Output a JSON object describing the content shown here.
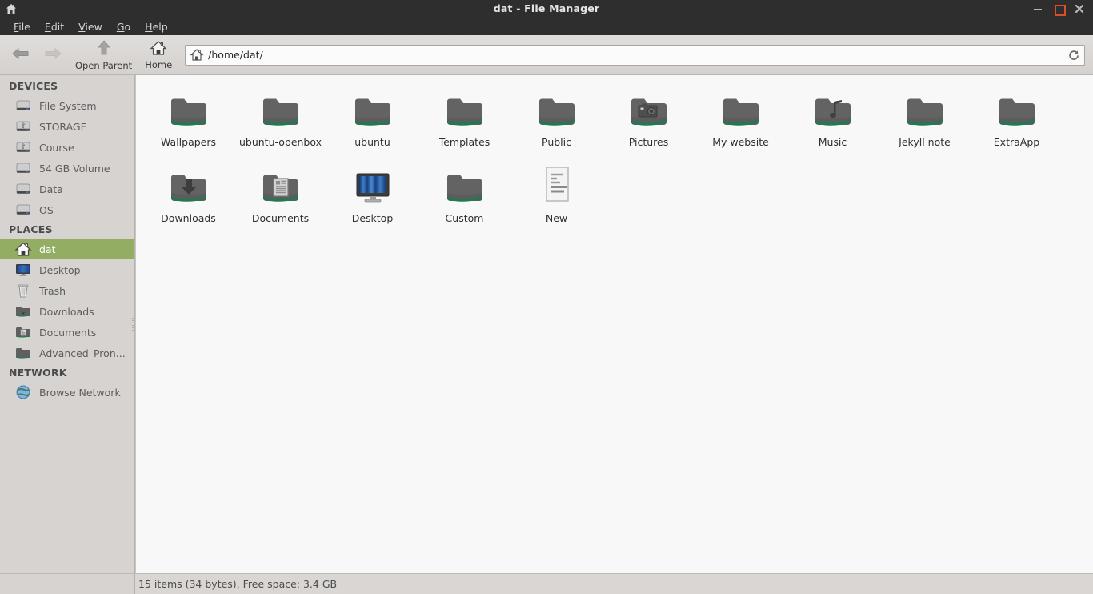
{
  "window": {
    "title": "dat - File Manager",
    "titlebar_icon": "home-icon",
    "controls": {
      "minimize": "minimize-icon",
      "maximize": "maximize-icon",
      "close": "close-icon"
    }
  },
  "menubar": {
    "items": [
      {
        "label": "File",
        "mnemonic": "F",
        "rest": "ile"
      },
      {
        "label": "Edit",
        "mnemonic": "E",
        "rest": "dit"
      },
      {
        "label": "View",
        "mnemonic": "V",
        "rest": "iew"
      },
      {
        "label": "Go",
        "mnemonic": "G",
        "rest": "o"
      },
      {
        "label": "Help",
        "mnemonic": "H",
        "rest": "elp"
      }
    ]
  },
  "toolbar": {
    "back_label": "",
    "forward_label": "",
    "open_parent_label": "Open Parent",
    "home_label": "Home",
    "path_value": "/home/dat/",
    "path_placeholder": "/home/dat/",
    "reload_label": ""
  },
  "sidebar": {
    "sections": [
      {
        "header": "DEVICES",
        "items": [
          {
            "label": "File System",
            "icon": "drive-icon",
            "selected": false
          },
          {
            "label": "STORAGE",
            "icon": "usb-drive-icon",
            "selected": false
          },
          {
            "label": "Course",
            "icon": "usb-drive-icon",
            "selected": false
          },
          {
            "label": "54 GB Volume",
            "icon": "drive-icon",
            "selected": false
          },
          {
            "label": "Data",
            "icon": "drive-icon",
            "selected": false
          },
          {
            "label": "OS",
            "icon": "drive-icon",
            "selected": false
          }
        ]
      },
      {
        "header": "PLACES",
        "items": [
          {
            "label": "dat",
            "icon": "home-icon",
            "selected": true
          },
          {
            "label": "Desktop",
            "icon": "monitor-icon",
            "selected": false
          },
          {
            "label": "Trash",
            "icon": "trash-icon",
            "selected": false
          },
          {
            "label": "Downloads",
            "icon": "downloads-folder-icon",
            "selected": false
          },
          {
            "label": "Documents",
            "icon": "documents-folder-icon",
            "selected": false
          },
          {
            "label": "Advanced_Pron...",
            "icon": "folder-icon",
            "selected": false
          }
        ]
      },
      {
        "header": "NETWORK",
        "items": [
          {
            "label": "Browse Network",
            "icon": "globe-icon",
            "selected": false
          }
        ]
      }
    ]
  },
  "files": [
    {
      "name": "Wallpapers",
      "icon": "folder-icon"
    },
    {
      "name": "ubuntu-openbox",
      "icon": "folder-icon"
    },
    {
      "name": "ubuntu",
      "icon": "folder-icon"
    },
    {
      "name": "Templates",
      "icon": "folder-icon"
    },
    {
      "name": "Public",
      "icon": "folder-icon"
    },
    {
      "name": "Pictures",
      "icon": "pictures-folder-icon"
    },
    {
      "name": "My website",
      "icon": "folder-icon"
    },
    {
      "name": "Music",
      "icon": "music-folder-icon"
    },
    {
      "name": "Jekyll note",
      "icon": "folder-icon"
    },
    {
      "name": "ExtraApp",
      "icon": "folder-icon"
    },
    {
      "name": "Downloads",
      "icon": "downloads-folder-icon"
    },
    {
      "name": "Documents",
      "icon": "documents-folder-icon"
    },
    {
      "name": "Desktop",
      "icon": "monitor-icon"
    },
    {
      "name": "Custom",
      "icon": "folder-icon"
    },
    {
      "name": "New",
      "icon": "text-document-icon"
    }
  ],
  "statusbar": {
    "text": "15 items (34 bytes), Free space: 3.4 GB"
  },
  "colors": {
    "titlebar_bg": "#2e2e2e",
    "selection_green": "#93ad63",
    "folder_gray": "#5a5a5a",
    "folder_accent_green": "#1f7a52",
    "maximize_orange": "#d94f2b",
    "content_bg": "#f8f8f8",
    "chrome_bg": "#d6d3d0"
  }
}
